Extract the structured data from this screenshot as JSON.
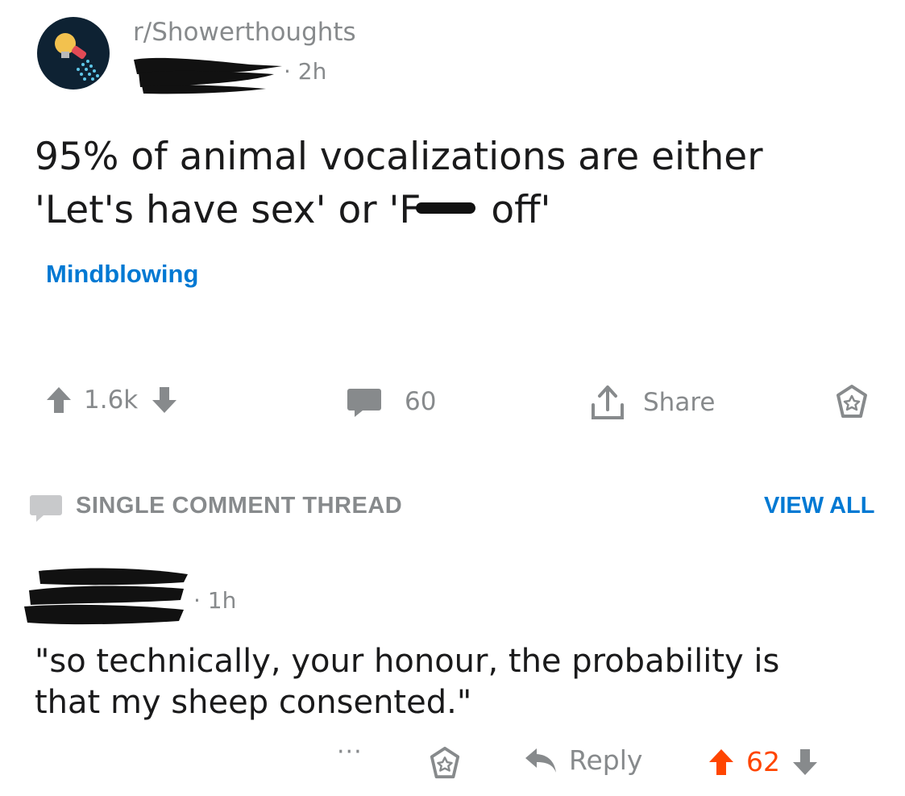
{
  "post": {
    "subreddit": "r/Showerthoughts",
    "age": "· 2h",
    "title_before": "95% of animal vocalizations are either 'Let's have sex' or 'F",
    "title_after": " off'",
    "flair": "Mindblowing",
    "score": "1.6k",
    "comments": "60",
    "share_label": "Share"
  },
  "thread": {
    "label": "SINGLE COMMENT THREAD",
    "view_all": "VIEW ALL"
  },
  "comment": {
    "age": "· 1h",
    "body": "\"so technically, your honour, the probability is that my sheep consented.\"",
    "more": "···",
    "reply_label": "Reply",
    "score": "62"
  },
  "colors": {
    "accent_blue": "#0079d3",
    "upvote_orange": "#ff4500",
    "muted_gray": "#878a8c",
    "avatar_bg": "#0e2233"
  },
  "icons": [
    "showerthoughts-avatar-icon",
    "upvote-icon",
    "downvote-icon",
    "comment-icon",
    "share-icon",
    "save-icon",
    "reply-icon"
  ]
}
